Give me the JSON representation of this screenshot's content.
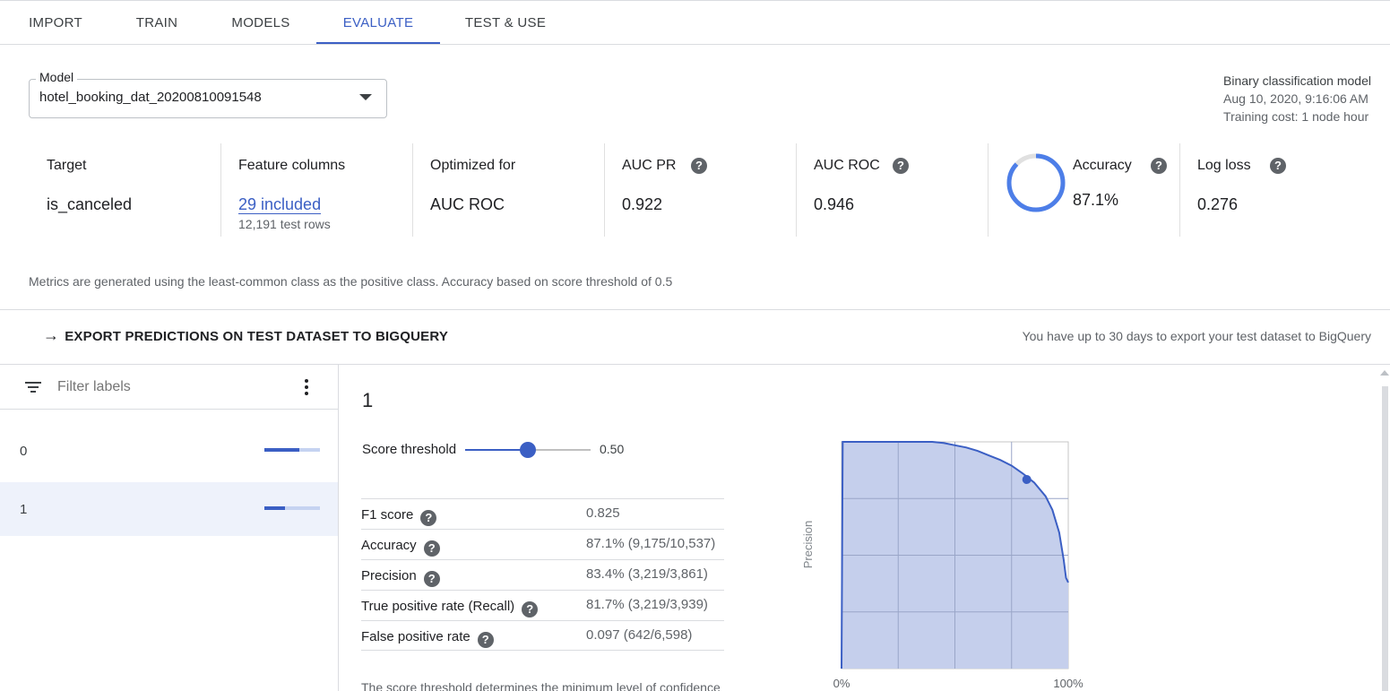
{
  "tabs": [
    {
      "label": "IMPORT"
    },
    {
      "label": "TRAIN"
    },
    {
      "label": "MODELS"
    },
    {
      "label": "EVALUATE",
      "active": true
    },
    {
      "label": "TEST & USE"
    }
  ],
  "model": {
    "legend": "Model",
    "value": "hotel_booking_dat_20200810091548"
  },
  "model_info": {
    "type": "Binary classification model",
    "date": "Aug 10, 2020, 9:16:06 AM",
    "cost": "Training cost: 1 node hour"
  },
  "metrics": {
    "target": {
      "label": "Target",
      "value": "is_canceled"
    },
    "features": {
      "label": "Feature columns",
      "value": "29 included",
      "sub": "12,191 test rows"
    },
    "optimized": {
      "label": "Optimized for",
      "value": "AUC ROC"
    },
    "auc_pr": {
      "label": "AUC PR",
      "value": "0.922"
    },
    "auc_roc": {
      "label": "AUC ROC",
      "value": "0.946"
    },
    "accuracy": {
      "label": "Accuracy",
      "value": "87.1%",
      "fraction": 0.871
    },
    "log_loss": {
      "label": "Log loss",
      "value": "0.276"
    }
  },
  "note": "Metrics are generated using the least-common class as the positive class. Accuracy based on score threshold of 0.5",
  "export": {
    "label": "EXPORT PREDICTIONS ON TEST DATASET TO BIGQUERY",
    "note": "You have up to 30 days to export your test dataset to BigQuery"
  },
  "filter": {
    "placeholder": "Filter labels"
  },
  "labels": [
    {
      "name": "0",
      "fraction": 0.63
    },
    {
      "name": "1",
      "fraction": 0.37,
      "selected": true
    }
  ],
  "detail": {
    "title": "1",
    "threshold_label": "Score threshold",
    "threshold_value": "0.50",
    "threshold_fraction": 0.5,
    "stats": [
      {
        "name": "F1 score",
        "value": "0.825"
      },
      {
        "name": "Accuracy",
        "value": "87.1% (9,175/10,537)"
      },
      {
        "name": "Precision",
        "value": "83.4% (3,219/3,861)"
      },
      {
        "name": "True positive rate (Recall)",
        "value": "81.7% (3,219/3,939)"
      },
      {
        "name": "False positive rate",
        "value": "0.097 (642/6,598)"
      }
    ],
    "bottom_text": "The score threshold determines the minimum level of confidence"
  },
  "chart_data": {
    "type": "area",
    "ylabel": "Precision",
    "xlabel": "",
    "x_tick_labels": [
      "0%",
      "100%"
    ],
    "xlim": [
      0,
      1
    ],
    "ylim": [
      0,
      1
    ],
    "grid": true,
    "fill_color": "#c5cfec",
    "line_color": "#3b5fc4",
    "series": [
      {
        "x": [
          0.0,
          0.005,
          0.1,
          0.2,
          0.3,
          0.4,
          0.45,
          0.5,
          0.55,
          0.6,
          0.65,
          0.7,
          0.75,
          0.8,
          0.85,
          0.9,
          0.93,
          0.96,
          0.98,
          0.99,
          1.0
        ],
        "y": [
          0.0,
          1.0,
          1.0,
          1.0,
          1.0,
          1.0,
          0.995,
          0.985,
          0.975,
          0.96,
          0.94,
          0.92,
          0.895,
          0.86,
          0.82,
          0.76,
          0.7,
          0.6,
          0.48,
          0.4,
          0.38
        ]
      }
    ],
    "highlight": {
      "x": 0.817,
      "y": 0.834
    }
  },
  "colors": {
    "accent": "#3b5fc4"
  }
}
